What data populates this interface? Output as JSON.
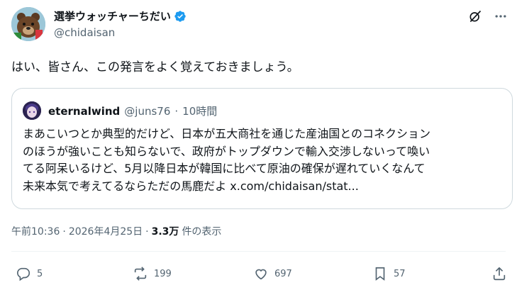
{
  "author": {
    "display_name": "選挙ウォッチャーちだい",
    "handle": "@chidaisan",
    "avatar": "bear-avatar",
    "verified_icon": "verified-badge-icon"
  },
  "header_icons": [
    "grok-icon",
    "more-icon"
  ],
  "tweet_text": "はい、皆さん、この発言をよく覚えておきましょう。",
  "quoted": {
    "display_name": "eternalwind",
    "handle": "@juns76",
    "separator": "·",
    "time": "10時間",
    "lines": [
      "まあこいつとか典型的だけど、日本が五大商社を通じた産油国とのコネクション",
      "のほうが強いことも知らないで、政府がトップダウンで輸入交渉しないって喚い",
      "てる阿呆いるけど、5月以降日本が韓国に比べて原油の確保が遅れていくなんて",
      "未来本気で考えてるならただの馬鹿だよ x.com/chidaisan/stat..."
    ]
  },
  "meta": {
    "time": "午前10:36",
    "sep1": "·",
    "date": "2026年4月25日",
    "sep2": "·",
    "views_count": "3.3万",
    "views_label": "件の表示"
  },
  "actions": {
    "reply": {
      "icon": "reply-icon",
      "count": "5"
    },
    "repost": {
      "icon": "repost-icon",
      "count": "199"
    },
    "like": {
      "icon": "like-icon",
      "count": "697"
    },
    "bookmark": {
      "icon": "bookmark-icon",
      "count": "57"
    },
    "share": {
      "icon": "share-icon"
    }
  },
  "colors": {
    "text": "#0f1419",
    "secondary": "#536471",
    "border": "#cfd9de",
    "verified": "#1d9bf0"
  }
}
